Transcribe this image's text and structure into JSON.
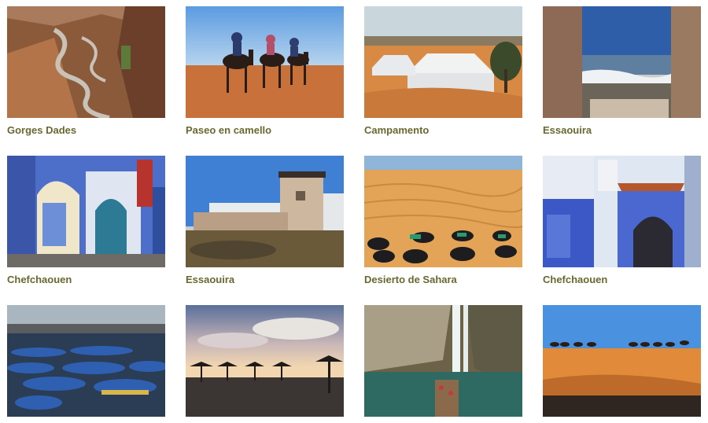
{
  "gallery": {
    "items": [
      {
        "caption": "Gorges Dades",
        "image": "winding-mountain-road-photo"
      },
      {
        "caption": "Paseo en camello",
        "image": "camel-ride-desert-photo"
      },
      {
        "caption": "Campamento",
        "image": "desert-tent-camp-photo"
      },
      {
        "caption": "Essaouira",
        "image": "sea-between-walls-photo"
      },
      {
        "caption": "Chefchaouen",
        "image": "blue-doorway-alley-photo"
      },
      {
        "caption": "Essaouira",
        "image": "coastal-fortress-photo"
      },
      {
        "caption": "Desierto de Sahara",
        "image": "sand-dunes-sandals-photo"
      },
      {
        "caption": "Chefchaouen",
        "image": "blue-house-arch-photo"
      },
      {
        "caption": "",
        "image": "blue-fishing-boats-photo"
      },
      {
        "caption": "",
        "image": "beach-sunset-umbrellas-photo"
      },
      {
        "caption": "",
        "image": "waterfall-boats-photo"
      },
      {
        "caption": "",
        "image": "camel-caravan-dunes-photo"
      }
    ]
  },
  "colors": {
    "caption": "#6a6830",
    "sky": "#4f8fd6",
    "sand": "#d98c45",
    "chefchaouen_blue": "#4e6fc9"
  }
}
